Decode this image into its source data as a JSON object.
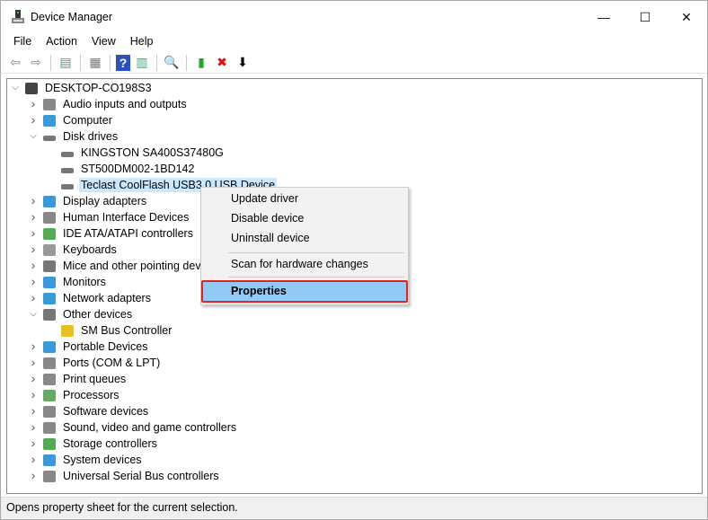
{
  "window": {
    "title": "Device Manager",
    "minimize": "—",
    "maximize": "☐",
    "close": "✕"
  },
  "menu": [
    "File",
    "Action",
    "View",
    "Help"
  ],
  "toolbar": [
    {
      "icon": "back-arrow-icon",
      "glyph": "⇦",
      "color": "#888"
    },
    {
      "icon": "forward-arrow-icon",
      "glyph": "⇨",
      "color": "#888"
    },
    {
      "sep": true
    },
    {
      "icon": "show-hide-console-tree-icon",
      "glyph": "▤",
      "color": "#3a7"
    },
    {
      "sep": true
    },
    {
      "icon": "properties-icon",
      "glyph": "▦",
      "color": "#777"
    },
    {
      "sep": true
    },
    {
      "icon": "help-icon",
      "glyph": "?",
      "color": "#fff",
      "bg": "#2a52be"
    },
    {
      "icon": "show-action-pane-icon",
      "glyph": "▥",
      "color": "#3a7"
    },
    {
      "sep": true
    },
    {
      "icon": "scan-hardware-icon",
      "glyph": "🔍",
      "color": "#39c"
    },
    {
      "sep": true
    },
    {
      "icon": "update-driver-icon",
      "glyph": "▮",
      "color": "#2a2"
    },
    {
      "icon": "uninstall-icon",
      "glyph": "✖",
      "color": "#e01010"
    },
    {
      "icon": "disable-device-icon",
      "glyph": "⬇",
      "color": "#000"
    }
  ],
  "tree": [
    {
      "label": "DESKTOP-CO198S3",
      "level": 0,
      "state": "open",
      "icon": "computer-icon",
      "color": "#444"
    },
    {
      "label": "Audio inputs and outputs",
      "level": 1,
      "state": "closed",
      "icon": "speaker-icon",
      "color": "#888"
    },
    {
      "label": "Computer",
      "level": 1,
      "state": "closed",
      "icon": "monitor-icon",
      "color": "#3a9ad9"
    },
    {
      "label": "Disk drives",
      "level": 1,
      "state": "open",
      "icon": "disk-icon",
      "color": "#777"
    },
    {
      "label": "KINGSTON SA400S37480G",
      "level": 2,
      "icon": "disk-icon",
      "color": "#777"
    },
    {
      "label": "ST500DM002-1BD142",
      "level": 2,
      "icon": "disk-icon",
      "color": "#777"
    },
    {
      "label": "Teclast CoolFlash USB3.0 USB Device",
      "level": 2,
      "icon": "disk-icon",
      "color": "#777",
      "selected": true
    },
    {
      "label": "Display adapters",
      "level": 1,
      "state": "closed",
      "icon": "display-adapter-icon",
      "color": "#3a9ad9"
    },
    {
      "label": "Human Interface Devices",
      "level": 1,
      "state": "closed",
      "icon": "hid-icon",
      "color": "#888"
    },
    {
      "label": "IDE ATA/ATAPI controllers",
      "level": 1,
      "state": "closed",
      "icon": "ide-controller-icon",
      "color": "#5a5"
    },
    {
      "label": "Keyboards",
      "level": 1,
      "state": "closed",
      "icon": "keyboard-icon",
      "color": "#999"
    },
    {
      "label": "Mice and other pointing devices",
      "level": 1,
      "state": "closed",
      "icon": "mouse-icon",
      "color": "#777"
    },
    {
      "label": "Monitors",
      "level": 1,
      "state": "closed",
      "icon": "monitor-icon",
      "color": "#3a9ad9"
    },
    {
      "label": "Network adapters",
      "level": 1,
      "state": "closed",
      "icon": "network-icon",
      "color": "#3a9ad9"
    },
    {
      "label": "Other devices",
      "level": 1,
      "state": "open",
      "icon": "unknown-device-icon",
      "color": "#777"
    },
    {
      "label": "SM Bus Controller",
      "level": 2,
      "icon": "warning-device-icon",
      "color": "#e8c020"
    },
    {
      "label": "Portable Devices",
      "level": 1,
      "state": "closed",
      "icon": "portable-device-icon",
      "color": "#3a9ad9"
    },
    {
      "label": "Ports (COM & LPT)",
      "level": 1,
      "state": "closed",
      "icon": "port-icon",
      "color": "#888"
    },
    {
      "label": "Print queues",
      "level": 1,
      "state": "closed",
      "icon": "printer-icon",
      "color": "#888"
    },
    {
      "label": "Processors",
      "level": 1,
      "state": "closed",
      "icon": "processor-icon",
      "color": "#6a6"
    },
    {
      "label": "Software devices",
      "level": 1,
      "state": "closed",
      "icon": "software-device-icon",
      "color": "#888"
    },
    {
      "label": "Sound, video and game controllers",
      "level": 1,
      "state": "closed",
      "icon": "sound-icon",
      "color": "#888"
    },
    {
      "label": "Storage controllers",
      "level": 1,
      "state": "closed",
      "icon": "storage-controller-icon",
      "color": "#5a5"
    },
    {
      "label": "System devices",
      "level": 1,
      "state": "closed",
      "icon": "system-device-icon",
      "color": "#3a9ad9"
    },
    {
      "label": "Universal Serial Bus controllers",
      "level": 1,
      "state": "closed",
      "icon": "usb-icon",
      "color": "#888"
    }
  ],
  "context_menu": {
    "items": [
      "Update driver",
      "Disable device",
      "Uninstall device",
      "Scan for hardware changes",
      "Properties"
    ],
    "highlighted": "Properties",
    "highlight_color": "#91c9f7",
    "outline_color": "#e8231f"
  },
  "status": "Opens property sheet for the current selection."
}
